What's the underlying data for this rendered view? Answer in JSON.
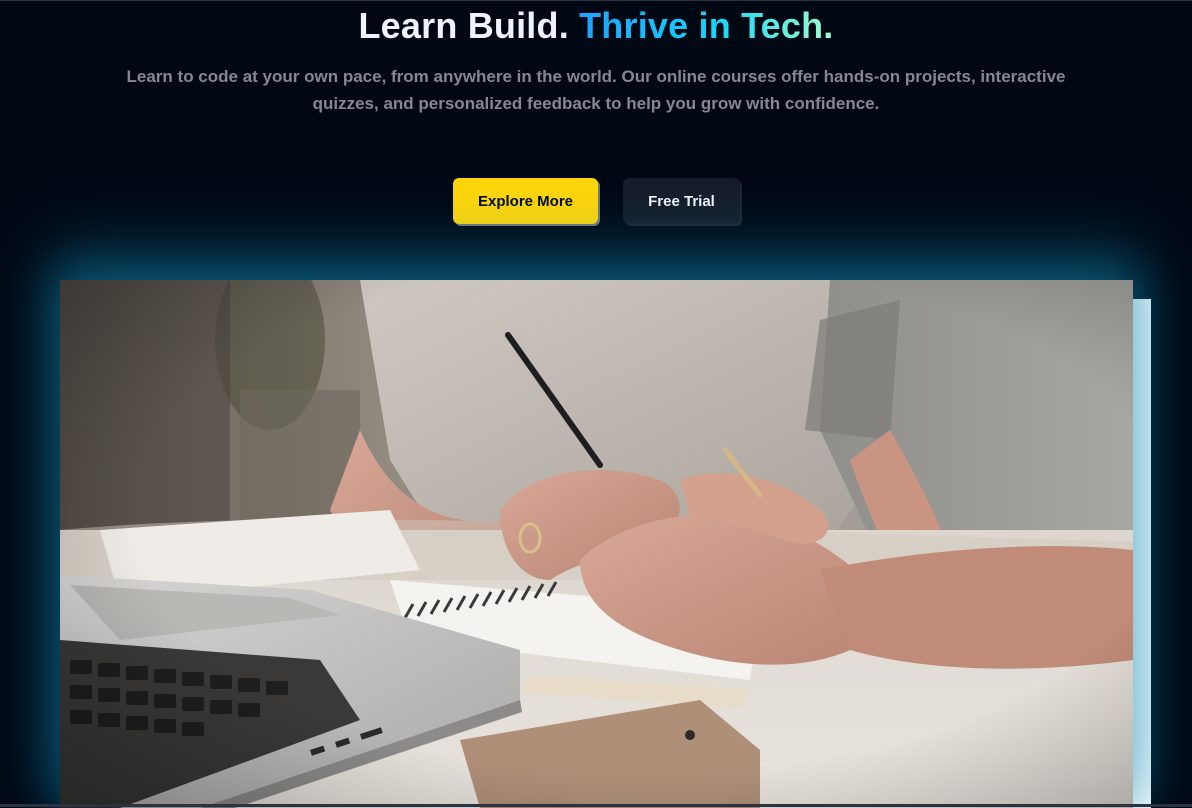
{
  "hero": {
    "headline_main": "Learn Build. ",
    "headline_accent": "Thrive in Tech.",
    "subtitle": "Learn to code at your own pace, from anywhere in the world. Our online courses offer hands-on projects, interactive quizzes, and personalized feedback to help you grow with confidence.",
    "primary_button": "Explore More",
    "secondary_button": "Free Trial"
  },
  "colors": {
    "background": "#000814",
    "heading": "#F1F2FF",
    "subtitle": "#838894",
    "accent_gradient_start": "#1FA2FF",
    "accent_gradient_end": "#12D8FA",
    "primary_button": "#FFD60A",
    "secondary_button": "#161D29",
    "media_glow": "#118AB2"
  },
  "media": {
    "subject": "hero-photo-students-writing-notes-with-laptop"
  }
}
